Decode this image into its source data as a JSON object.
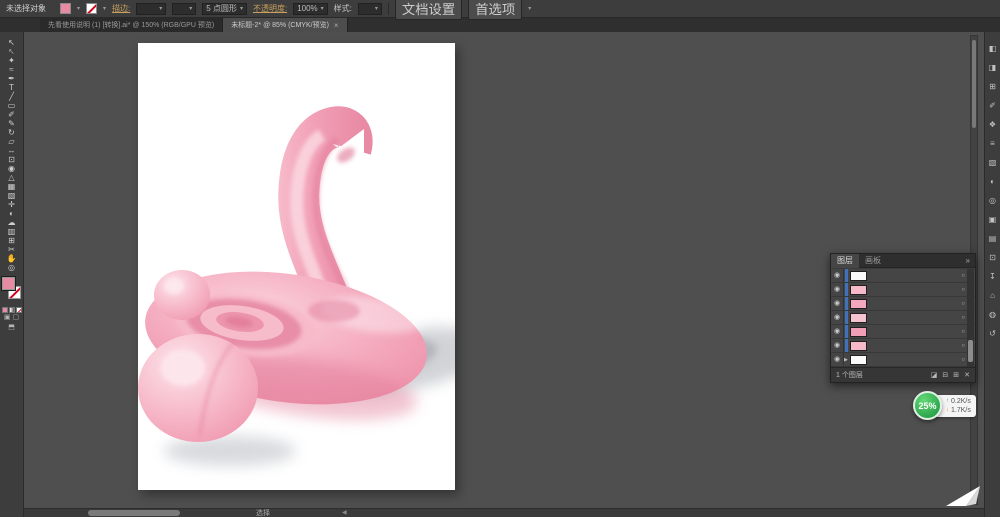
{
  "colors": {
    "accent_pink": "#e78aa4",
    "label_gold": "#c9a05e",
    "selection_blue": "#3f71bd",
    "badge_green": "#2aa84e",
    "artboard_white": "#ffffff"
  },
  "control_bar": {
    "status_text": "未选择对象",
    "fill_dropdown_arrow": "▾",
    "stroke_dropdown_arrow": "▾",
    "stroke_label": "描边:",
    "stroke_weight_arrow": "▾",
    "width_profile_arrow": "▾",
    "brush_value": "5 点圆形",
    "brush_dropdown_arrow": "▾",
    "opacity_label": "不透明度:",
    "opacity_value": "100%",
    "opacity_dropdown_arrow": "▾",
    "style_label": "样式:",
    "style_dropdown_arrow": "▾",
    "document_setup_label": "文档设置",
    "preferences_label": "首选项",
    "panel_menu_arrow": "▾"
  },
  "tab_bar": {
    "tabs": [
      {
        "label": "先看使用说明 (1) [转换].ai* @ 150% (RGB/GPU 预览)"
      },
      {
        "label": "未标题-2* @ 85% (CMYK/预览)",
        "close_glyph": "×"
      }
    ]
  },
  "toolbar": {
    "tools": [
      {
        "name": "selection-tool",
        "glyph": "↖"
      },
      {
        "name": "direct-selection-tool",
        "glyph": "↖"
      },
      {
        "name": "magic-wand-tool",
        "glyph": "✦"
      },
      {
        "name": "lasso-tool",
        "glyph": "≈"
      },
      {
        "name": "pen-tool",
        "glyph": "✒"
      },
      {
        "name": "type-tool",
        "glyph": "T"
      },
      {
        "name": "line-segment-tool",
        "glyph": "╱"
      },
      {
        "name": "rectangle-tool",
        "glyph": "▭"
      },
      {
        "name": "paintbrush-tool",
        "glyph": "✐"
      },
      {
        "name": "pencil-tool",
        "glyph": "✎"
      },
      {
        "name": "rotate-tool",
        "glyph": "↻"
      },
      {
        "name": "scale-tool",
        "glyph": "▱"
      },
      {
        "name": "width-tool",
        "glyph": "↔"
      },
      {
        "name": "free-transform-tool",
        "glyph": "⊡"
      },
      {
        "name": "shape-builder-tool",
        "glyph": "◉"
      },
      {
        "name": "perspective-grid-tool",
        "glyph": "△"
      },
      {
        "name": "mesh-tool",
        "glyph": "▦"
      },
      {
        "name": "gradient-tool",
        "glyph": "▧"
      },
      {
        "name": "eyedropper-tool",
        "glyph": "✛"
      },
      {
        "name": "blend-tool",
        "glyph": "◐"
      },
      {
        "name": "symbol-sprayer-tool",
        "glyph": "☁"
      },
      {
        "name": "column-graph-tool",
        "glyph": "▥"
      },
      {
        "name": "artboard-tool",
        "glyph": "⊞"
      },
      {
        "name": "slice-tool",
        "glyph": "✂"
      },
      {
        "name": "hand-tool",
        "glyph": "✋"
      },
      {
        "name": "zoom-tool",
        "glyph": "◎"
      }
    ],
    "footer_glyph_modes": "▣ ▢",
    "footer_glyph_screen": "⬒"
  },
  "right_dock": {
    "icons": [
      {
        "name": "color-panel-icon",
        "glyph": "◧"
      },
      {
        "name": "color-guide-panel-icon",
        "glyph": "◨"
      },
      {
        "name": "swatches-panel-icon",
        "glyph": "⊞"
      },
      {
        "name": "brushes-panel-icon",
        "glyph": "✐"
      },
      {
        "name": "symbols-panel-icon",
        "glyph": "❖"
      },
      {
        "name": "stroke-panel-icon",
        "glyph": "≡"
      },
      {
        "name": "gradient-panel-icon",
        "glyph": "▧"
      },
      {
        "name": "transparency-panel-icon",
        "glyph": "◐"
      },
      {
        "name": "appearance-panel-icon",
        "glyph": "◎"
      },
      {
        "name": "graphic-styles-panel-icon",
        "glyph": "▣"
      },
      {
        "name": "layers-panel-icon",
        "glyph": "▤"
      },
      {
        "name": "artboards-panel-icon",
        "glyph": "⊡"
      },
      {
        "name": "asset-export-panel-icon",
        "glyph": "↧"
      },
      {
        "name": "libraries-panel-icon",
        "glyph": "⌂"
      },
      {
        "name": "info-panel-icon",
        "glyph": "◍"
      },
      {
        "name": "history-panel-icon",
        "glyph": "↺"
      }
    ]
  },
  "layers_panel": {
    "layers_tab": "图层",
    "artboards_tab": "画板",
    "collapse_glyph": "»",
    "eye_glyph": "◉",
    "target_glyph": "○",
    "expander_glyph": "▶",
    "footer_count": "1 个图层",
    "footer_icons": [
      {
        "name": "clipping-mask-icon",
        "glyph": "◪"
      },
      {
        "name": "new-sublayer-icon",
        "glyph": "⊟"
      },
      {
        "name": "new-layer-icon",
        "glyph": "⊞"
      },
      {
        "name": "delete-layer-icon",
        "glyph": "✕"
      }
    ]
  },
  "speed_badge": {
    "percent": "25%",
    "up_arrow": "↑",
    "upload": "0.2K/s",
    "down_arrow": "↓",
    "download": "1.7K/s"
  },
  "status_bar": {
    "tool_name": "选择",
    "nav_left": "◀"
  }
}
